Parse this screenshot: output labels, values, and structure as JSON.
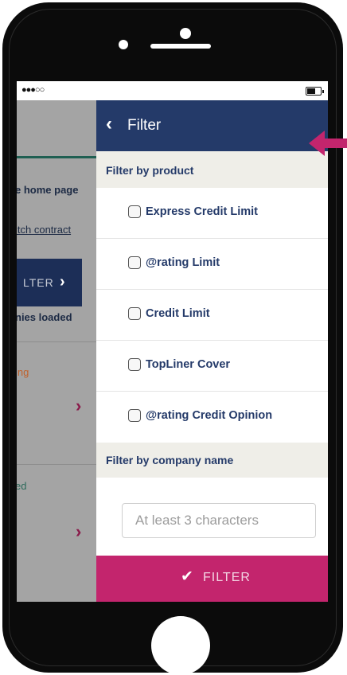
{
  "status_bar": {
    "signal": "●●●○○"
  },
  "background_app": {
    "home_link": "e home page",
    "switch_link": "itch contract",
    "filter_button": "LTER",
    "loaded_text": "nies loaded",
    "item1_status": "ing",
    "item2_status": "ed"
  },
  "filter_panel": {
    "title": "Filter",
    "product_section": "Filter by product",
    "products": [
      {
        "label": "Express Credit Limit",
        "checked": false
      },
      {
        "label": "@rating Limit",
        "checked": false
      },
      {
        "label": "Credit Limit",
        "checked": false
      },
      {
        "label": "TopLiner Cover",
        "checked": false
      },
      {
        "label": "@rating Credit Opinion",
        "checked": false
      }
    ],
    "company_section": "Filter by company name",
    "company_input": {
      "value": "",
      "placeholder": "At least 3 characters"
    },
    "filter_button": "FILTER"
  },
  "colors": {
    "header": "#243a69",
    "accent": "#c3256d",
    "text": "#243a69",
    "section_bg": "#efeee8"
  },
  "icons": [
    "back-chevron-icon",
    "checkmark-icon",
    "chevron-right-icon",
    "pointer-arrow-icon"
  ]
}
